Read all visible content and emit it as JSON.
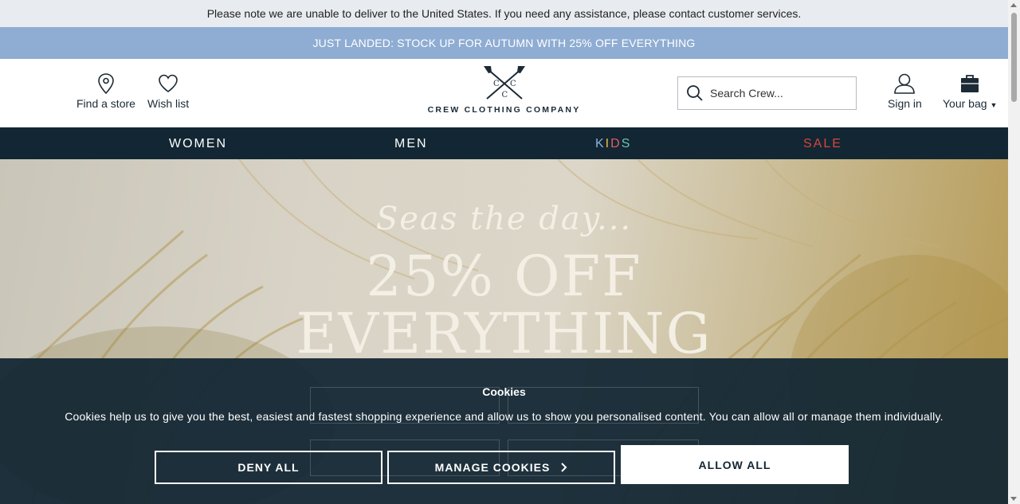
{
  "notice": {
    "text": "Please note we are unable to deliver to the United States. If you need any assistance, please contact customer services."
  },
  "promo": {
    "text": "JUST LANDED: STOCK UP FOR AUTUMN WITH 25% OFF EVERYTHING"
  },
  "header": {
    "find_store": "Find a store",
    "wish_list": "Wish list",
    "logo_text": "CREW CLOTHING COMPANY",
    "logo_letter": "C",
    "search_placeholder": "Search Crew...",
    "sign_in": "Sign in",
    "your_bag": "Your bag"
  },
  "nav": {
    "women": "WOMEN",
    "men": "MEN",
    "kids": [
      "K",
      "I",
      "D",
      "S"
    ],
    "sale": "SALE"
  },
  "hero": {
    "script": "Seas the day...",
    "line1": "25% OFF",
    "line2": "EVERYTHING"
  },
  "cookies": {
    "title": "Cookies",
    "text": "Cookies help us to give you the best, easiest and fastest shopping experience and allow us to show you personalised content. You can allow all or manage them individually.",
    "deny": "DENY ALL",
    "manage": "MANAGE COOKIES",
    "allow": "ALLOW ALL"
  },
  "colors": {
    "navy": "#122633",
    "promo_blue": "#8fadd3",
    "sale_red": "#d9463a",
    "notice_bg": "#e8ebef"
  }
}
